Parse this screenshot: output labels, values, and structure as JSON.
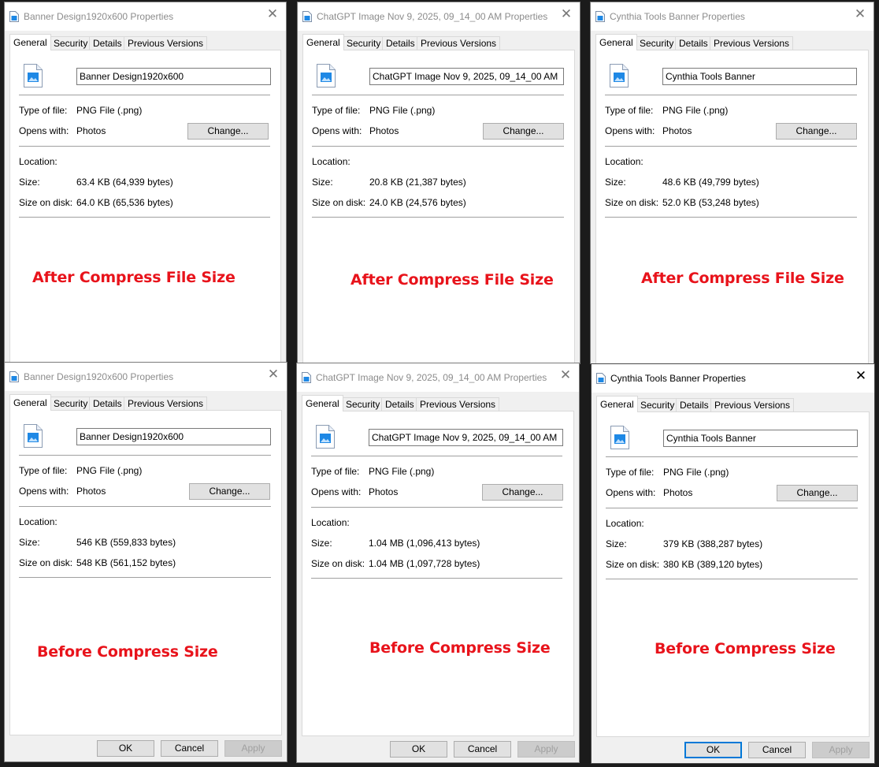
{
  "dialogs": [
    {
      "title": "Banner Design1920x600 Properties",
      "filename": "Banner Design1920x600",
      "type_label": "Type of file:",
      "type_value": "PNG File (.png)",
      "opens_label": "Opens with:",
      "opens_value": "Photos",
      "change_label": "Change...",
      "location_label": "Location:",
      "size_label": "Size:",
      "size_value": "63.4 KB (64,939 bytes)",
      "disk_label": "Size on disk:",
      "disk_value": "64.0 KB (65,536 bytes)",
      "annotation": "After Compress File Size"
    },
    {
      "title": "ChatGPT Image Nov 9, 2025, 09_14_00 AM Properties",
      "filename": "ChatGPT Image Nov 9, 2025, 09_14_00 AM",
      "type_label": "Type of file:",
      "type_value": "PNG File (.png)",
      "opens_label": "Opens with:",
      "opens_value": "Photos",
      "change_label": "Change...",
      "location_label": "Location:",
      "size_label": "Size:",
      "size_value": "20.8 KB (21,387 bytes)",
      "disk_label": "Size on disk:",
      "disk_value": "24.0 KB (24,576 bytes)",
      "annotation": "After Compress File Size"
    },
    {
      "title": "Cynthia Tools Banner Properties",
      "filename": "Cynthia Tools Banner",
      "type_label": "Type of file:",
      "type_value": "PNG File (.png)",
      "opens_label": "Opens with:",
      "opens_value": "Photos",
      "change_label": "Change...",
      "location_label": "Location:",
      "size_label": "Size:",
      "size_value": "48.6 KB (49,799 bytes)",
      "disk_label": "Size on disk:",
      "disk_value": "52.0 KB (53,248 bytes)",
      "annotation": "After Compress File Size"
    },
    {
      "title": "Banner Design1920x600 Properties",
      "filename": "Banner Design1920x600",
      "type_label": "Type of file:",
      "type_value": "PNG File (.png)",
      "opens_label": "Opens with:",
      "opens_value": "Photos",
      "change_label": "Change...",
      "location_label": "Location:",
      "size_label": "Size:",
      "size_value": "546 KB (559,833 bytes)",
      "disk_label": "Size on disk:",
      "disk_value": "548 KB (561,152 bytes)",
      "annotation": "Before Compress Size"
    },
    {
      "title": "ChatGPT Image Nov 9, 2025, 09_14_00 AM Properties",
      "filename": "ChatGPT Image Nov 9, 2025, 09_14_00 AM",
      "type_label": "Type of file:",
      "type_value": "PNG File (.png)",
      "opens_label": "Opens with:",
      "opens_value": "Photos",
      "change_label": "Change...",
      "location_label": "Location:",
      "size_label": "Size:",
      "size_value": "1.04 MB (1,096,413 bytes)",
      "disk_label": "Size on disk:",
      "disk_value": "1.04 MB (1,097,728 bytes)",
      "annotation": "Before Compress Size"
    },
    {
      "title": "Cynthia Tools Banner Properties",
      "filename": "Cynthia Tools Banner",
      "type_label": "Type of file:",
      "type_value": "PNG File (.png)",
      "opens_label": "Opens with:",
      "opens_value": "Photos",
      "change_label": "Change...",
      "location_label": "Location:",
      "size_label": "Size:",
      "size_value": "379 KB (388,287 bytes)",
      "disk_label": "Size on disk:",
      "disk_value": "380 KB (389,120 bytes)",
      "annotation": "Before Compress Size"
    }
  ],
  "tabs": [
    "General",
    "Security",
    "Details",
    "Previous Versions"
  ],
  "buttons": {
    "ok": "OK",
    "cancel": "Cancel",
    "apply": "Apply"
  },
  "close_glyph": "✕",
  "colors": {
    "annotation": "#e8131b",
    "default_button_border": "#0078d7",
    "icon_blue": "#1e88e5"
  }
}
